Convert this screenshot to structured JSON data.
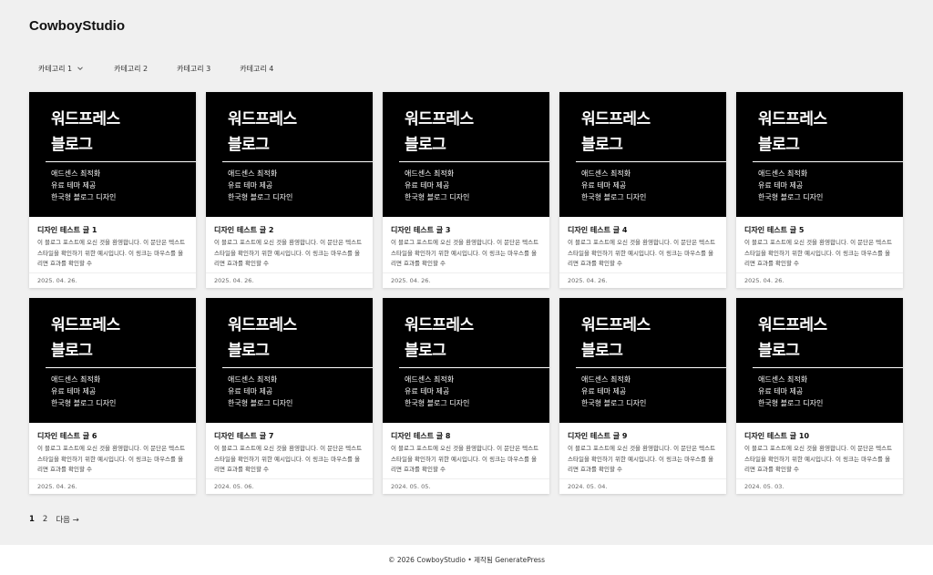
{
  "site": {
    "title": "CowboyStudio"
  },
  "nav": {
    "items": [
      {
        "label": "카테고리 1",
        "has_dropdown": true
      },
      {
        "label": "카테고리 2",
        "has_dropdown": false
      },
      {
        "label": "카테고리 3",
        "has_dropdown": false
      },
      {
        "label": "카테고리 4",
        "has_dropdown": false
      }
    ]
  },
  "posts": [
    {
      "thumb_line1": "워드프레스",
      "thumb_line2": "블로그",
      "thumb_sub1": "애드센스 최적화",
      "thumb_sub2": "유료 테마 제공",
      "thumb_sub3": "한국형 블로그 디자인",
      "title": "디자인 테스트 글 1",
      "excerpt": "이 블로그 포스트에 오신 것을 환영합니다. 이 문단은 텍스트 스타일을 확인하기 위한 예시입니다. 이 링크는 마우스를 올리면 효과를 확인할 수",
      "date": "2025. 04. 26."
    },
    {
      "thumb_line1": "워드프레스",
      "thumb_line2": "블로그",
      "thumb_sub1": "애드센스 최적화",
      "thumb_sub2": "유료 테마 제공",
      "thumb_sub3": "한국형 블로그 디자인",
      "title": "디자인 테스트 글 2",
      "excerpt": "이 블로그 포스트에 오신 것을 환영합니다. 이 문단은 텍스트 스타일을 확인하기 위한 예시입니다. 이 링크는 마우스를 올리면 효과를 확인할 수",
      "date": "2025. 04. 26."
    },
    {
      "thumb_line1": "워드프레스",
      "thumb_line2": "블로그",
      "thumb_sub1": "애드센스 최적화",
      "thumb_sub2": "유료 테마 제공",
      "thumb_sub3": "한국형 블로그 디자인",
      "title": "디자인 테스트 글 3",
      "excerpt": "이 블로그 포스트에 오신 것을 환영합니다. 이 문단은 텍스트 스타일을 확인하기 위한 예시입니다. 이 링크는 마우스를 올리면 효과를 확인할 수",
      "date": "2025. 04. 26."
    },
    {
      "thumb_line1": "워드프레스",
      "thumb_line2": "블로그",
      "thumb_sub1": "애드센스 최적화",
      "thumb_sub2": "유료 테마 제공",
      "thumb_sub3": "한국형 블로그 디자인",
      "title": "디자인 테스트 글 4",
      "excerpt": "이 블로그 포스트에 오신 것을 환영합니다. 이 문단은 텍스트 스타일을 확인하기 위한 예시입니다. 이 링크는 마우스를 올리면 효과를 확인할 수",
      "date": "2025. 04. 26."
    },
    {
      "thumb_line1": "워드프레스",
      "thumb_line2": "블로그",
      "thumb_sub1": "애드센스 최적화",
      "thumb_sub2": "유료 테마 제공",
      "thumb_sub3": "한국형 블로그 디자인",
      "title": "디자인 테스트 글 5",
      "excerpt": "이 블로그 포스트에 오신 것을 환영합니다. 이 문단은 텍스트 스타일을 확인하기 위한 예시입니다. 이 링크는 마우스를 올리면 효과를 확인할 수",
      "date": "2025. 04. 26."
    },
    {
      "thumb_line1": "워드프레스",
      "thumb_line2": "블로그",
      "thumb_sub1": "애드센스 최적화",
      "thumb_sub2": "유료 테마 제공",
      "thumb_sub3": "한국형 블로그 디자인",
      "title": "디자인 테스트 글 6",
      "excerpt": "이 블로그 포스트에 오신 것을 환영합니다. 이 문단은 텍스트 스타일을 확인하기 위한 예시입니다. 이 링크는 마우스를 올리면 효과를 확인할 수",
      "date": "2025. 04. 26."
    },
    {
      "thumb_line1": "워드프레스",
      "thumb_line2": "블로그",
      "thumb_sub1": "애드센스 최적화",
      "thumb_sub2": "유료 테마 제공",
      "thumb_sub3": "한국형 블로그 디자인",
      "title": "디자인 테스트 글 7",
      "excerpt": "이 블로그 포스트에 오신 것을 환영합니다. 이 문단은 텍스트 스타일을 확인하기 위한 예시입니다. 이 링크는 마우스를 올리면 효과를 확인할 수",
      "date": "2024. 05. 06."
    },
    {
      "thumb_line1": "워드프레스",
      "thumb_line2": "블로그",
      "thumb_sub1": "애드센스 최적화",
      "thumb_sub2": "유료 테마 제공",
      "thumb_sub3": "한국형 블로그 디자인",
      "title": "디자인 테스트 글 8",
      "excerpt": "이 블로그 포스트에 오신 것을 환영합니다. 이 문단은 텍스트 스타일을 확인하기 위한 예시입니다. 이 링크는 마우스를 올리면 효과를 확인할 수",
      "date": "2024. 05. 05."
    },
    {
      "thumb_line1": "워드프레스",
      "thumb_line2": "블로그",
      "thumb_sub1": "애드센스 최적화",
      "thumb_sub2": "유료 테마 제공",
      "thumb_sub3": "한국형 블로그 디자인",
      "title": "디자인 테스트 글 9",
      "excerpt": "이 블로그 포스트에 오신 것을 환영합니다. 이 문단은 텍스트 스타일을 확인하기 위한 예시입니다. 이 링크는 마우스를 올리면 효과를 확인할 수",
      "date": "2024. 05. 04."
    },
    {
      "thumb_line1": "워드프레스",
      "thumb_line2": "블로그",
      "thumb_sub1": "애드센스 최적화",
      "thumb_sub2": "유료 테마 제공",
      "thumb_sub3": "한국형 블로그 디자인",
      "title": "디자인 테스트 글 10",
      "excerpt": "이 블로그 포스트에 오신 것을 환영합니다. 이 문단은 텍스트 스타일을 확인하기 위한 예시입니다. 이 링크는 마우스를 올리면 효과를 확인할 수",
      "date": "2024. 05. 03."
    }
  ],
  "pagination": {
    "pages": [
      {
        "label": "1",
        "current": true
      },
      {
        "label": "2",
        "current": false
      }
    ],
    "next_label": "다음 →"
  },
  "footer": {
    "text": "© 2026 CowboyStudio • 제작됨 GeneratePress"
  },
  "colors": {
    "background": "#f0f0f0",
    "thumbnail": "#000000",
    "card": "#ffffff"
  }
}
